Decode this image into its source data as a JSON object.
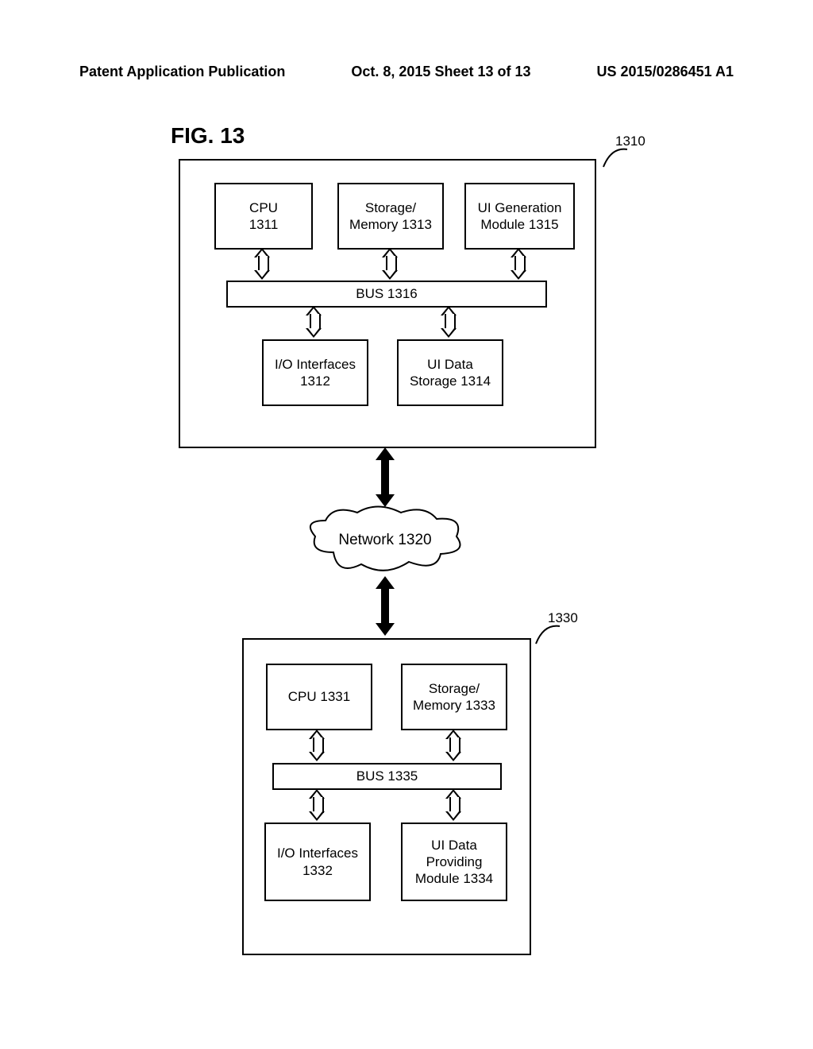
{
  "header": {
    "left": "Patent Application Publication",
    "center": "Oct. 8, 2015  Sheet 13 of 13",
    "right": "US 2015/0286451 A1"
  },
  "figure_label": "FIG. 13",
  "device_top": {
    "ref": "1310",
    "cpu": "CPU\n1311",
    "storage": "Storage/\nMemory 1313",
    "uigen": "UI Generation\nModule 1315",
    "bus": "BUS 1316",
    "io": "I/O Interfaces\n1312",
    "uidata": "UI Data\nStorage 1314"
  },
  "network": "Network 1320",
  "device_bottom": {
    "ref": "1330",
    "cpu": "CPU 1331",
    "storage": "Storage/\nMemory 1333",
    "bus": "BUS 1335",
    "io": "I/O Interfaces\n1332",
    "uiprov": "UI Data\nProviding\nModule 1334"
  }
}
